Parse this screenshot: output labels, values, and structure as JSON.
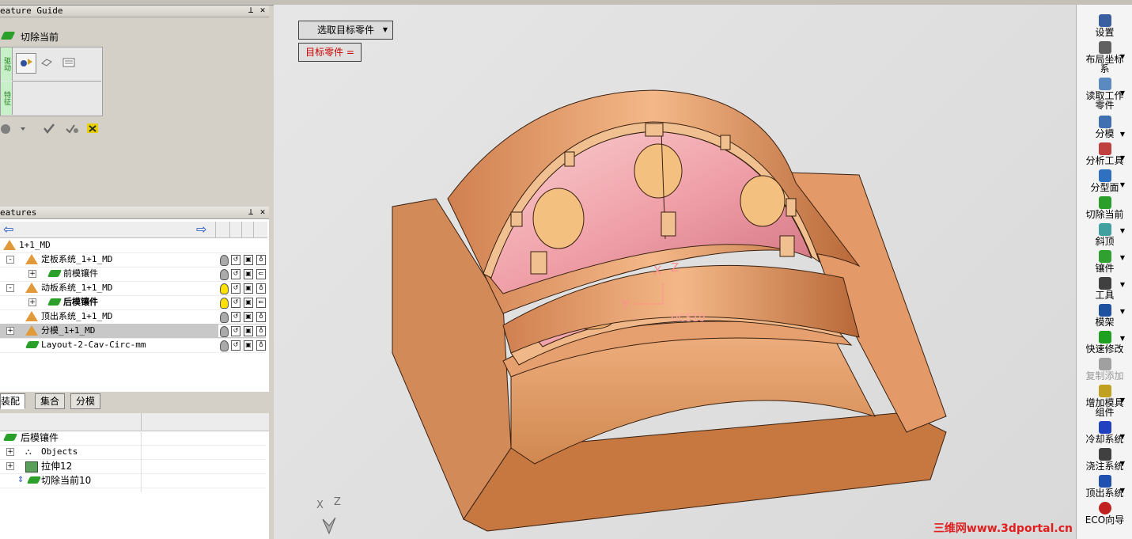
{
  "feature_guide": {
    "title": "eature Guide",
    "action_label": "切除当前",
    "side_tab_1": "驱动",
    "side_tab_2": "特征",
    "pin": "ꟷ",
    "close": "✕"
  },
  "features": {
    "title": "eatures",
    "rows": [
      {
        "label": "1+1_MD",
        "expander": "",
        "bold": false
      },
      {
        "label": "定板系统_1+1_MD",
        "expander": "-",
        "bold": false
      },
      {
        "label": "前模镶件",
        "expander": "+",
        "bold": false
      },
      {
        "label": "动板系统_1+1_MD",
        "expander": "-",
        "bold": false
      },
      {
        "label": "后模镶件",
        "expander": "+",
        "bold": true
      },
      {
        "label": "顶出系统_1+1_MD",
        "expander": "",
        "bold": false
      },
      {
        "label": "分模_1+1_MD",
        "expander": "+",
        "bold": false
      },
      {
        "label": "Layout-2-Cav-Circ-mm",
        "expander": "",
        "bold": false
      }
    ],
    "tabs": [
      "装配",
      "集合",
      "分模"
    ]
  },
  "detail_tree": {
    "rows": [
      {
        "label": "后模镶件"
      },
      {
        "label": "Objects"
      },
      {
        "label": "拉伸12"
      },
      {
        "label": "切除当前10"
      }
    ]
  },
  "viewport": {
    "select_button": "选取目标零件",
    "target_label": "目标零件 =",
    "axis_x": "X",
    "axis_z": "Z",
    "axis_y": "Y",
    "ucs_label": "UCS10",
    "triad_x": "X",
    "triad_z": "Z",
    "watermark": "三维网www.3dportal.cn"
  },
  "right_toolbar": [
    {
      "label": "设置",
      "arrow": false,
      "color": "#3a5fa0"
    },
    {
      "label": "布局坐标系",
      "arrow": true,
      "color": "#606060"
    },
    {
      "label": "读取工作零件",
      "arrow": true,
      "color": "#5a8ac0"
    },
    {
      "label": "分模",
      "arrow": true,
      "color": "#4070b0"
    },
    {
      "label": "分析工具",
      "arrow": true,
      "color": "#c04040"
    },
    {
      "label": "分型面",
      "arrow": true,
      "color": "#3070c0"
    },
    {
      "label": "切除当前",
      "arrow": false,
      "color": "#2aa02a"
    },
    {
      "label": "斜顶",
      "arrow": true,
      "color": "#40a0a0"
    },
    {
      "label": "镶件",
      "arrow": true,
      "color": "#30a030"
    },
    {
      "label": "工具",
      "arrow": true,
      "color": "#404040"
    },
    {
      "label": "模架",
      "arrow": true,
      "color": "#2050a0"
    },
    {
      "label": "快速修改",
      "arrow": true,
      "color": "#20a020"
    },
    {
      "label": "复制添加",
      "arrow": false,
      "color": "#a0a0a0"
    },
    {
      "label": "增加模具组件",
      "arrow": true,
      "color": "#c0a020"
    },
    {
      "label": "冷却系统",
      "arrow": true,
      "color": "#2040c0"
    },
    {
      "label": "浇注系统",
      "arrow": true,
      "color": "#404040"
    },
    {
      "label": "顶出系统",
      "arrow": true,
      "color": "#2050b0"
    },
    {
      "label": "ECO向导",
      "arrow": false,
      "color": "#c02020"
    }
  ],
  "colors": {
    "part_copper": "#d9895a",
    "part_pink": "#f2a6a6",
    "accent_red": "#cc0000"
  }
}
